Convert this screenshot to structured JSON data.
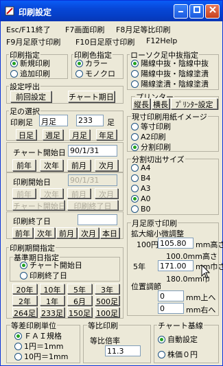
{
  "window": {
    "title": "印刷設定"
  },
  "menu": {
    "row1": [
      "Esc/F11終了",
      "F7画面印刷",
      "F8月足等比印刷"
    ],
    "row2": [
      "F9月足原寸印刷",
      "F10日足原寸印刷",
      "F12Help"
    ]
  },
  "print_spec": {
    "title": "印刷指定",
    "options": [
      "新規印刷",
      "追加印刷"
    ],
    "selected": 0
  },
  "print_color": {
    "title": "印刷色指定",
    "options": [
      "カラー",
      "モノクロ"
    ],
    "selected": 0
  },
  "candle": {
    "title": "ローソク足中抜指定",
    "options": [
      "陽線中抜・陰線中抜",
      "陽線中抜・陰線塗潰",
      "陽線塗潰・陰線塗潰"
    ],
    "selected": 0
  },
  "settings_call": {
    "title": "設定呼出",
    "prev_button": "前回設定",
    "chart_period_button": "チャート期日"
  },
  "printer": {
    "title": "プリンター",
    "buttons": [
      "縦長",
      "横長",
      "ﾌﾟﾘﾝﾀｰ設定"
    ]
  },
  "foot": {
    "title": "足の選択",
    "print_foot_label": "印刷足",
    "print_foot_value": "月足",
    "count_value": "233",
    "count_unit": "足",
    "buttons": [
      "日足",
      "週足",
      "月足",
      "年足"
    ]
  },
  "chart_start": {
    "label": "チャート開始日",
    "value": "90/1/31",
    "buttons": [
      "前年",
      "次年",
      "前月",
      "次月"
    ]
  },
  "print_start": {
    "label": "印刷開始日",
    "value": "90/1/31",
    "buttons": [
      "前年",
      "次年",
      "前月",
      "次月"
    ],
    "chart_start_button": "チャート開始日",
    "print_end_button": "印刷終了日"
  },
  "print_end": {
    "label": "印刷終了日",
    "value": "",
    "buttons": [
      "前年",
      "次年",
      "前月",
      "次月",
      "本日"
    ]
  },
  "paper_image": {
    "title": "現寸印刷用紙イメージ",
    "options": [
      "等寸印刷",
      "A2印刷",
      "分割印刷"
    ],
    "selected": 2
  },
  "split_size": {
    "title": "分割切出サイズ",
    "options": [
      "A4",
      "B4",
      "A3",
      "A0",
      "B0"
    ],
    "selected": 3
  },
  "month_print": {
    "title": "月足原寸印刷",
    "zoom_label": "拡大縮小微調整",
    "row100_label": "100円",
    "row100_value": "105.80",
    "row100_unit": "mm高さ",
    "row100_ref": "100.0mm高さ",
    "row5_label": "5年",
    "row5_value": "171.00",
    "row5_unit": "mm巾さ",
    "row5_ref": "180.0mm巾",
    "pos_label": "位置調節",
    "pos_up_value": "0",
    "pos_up_unit": "mm上へ",
    "pos_right_value": "0",
    "pos_right_unit": "mm右へ"
  },
  "period": {
    "title": "印刷期間指定",
    "basis_title": "基準期日指定",
    "basis_options": [
      "チャート開始日",
      "印刷終了日"
    ],
    "basis_selected": 0,
    "grid": [
      [
        "20年",
        "10年",
        "5年",
        "3年"
      ],
      [
        "2年",
        "1年",
        "6月",
        "500足"
      ],
      [
        "264足",
        "233足",
        "150足",
        "100足"
      ]
    ]
  },
  "unit": {
    "title": "等差印刷単位",
    "options": [
      "ＦＡＩ規格",
      "1円＝1mm",
      "10円＝1mm"
    ],
    "selected": 0
  },
  "ratio": {
    "title": "等比印刷",
    "label": "等比倍率",
    "value": "11.3"
  },
  "baseline": {
    "title": "チャート基線",
    "options": [
      "自動設定",
      "株価０円"
    ],
    "selected": 0
  }
}
